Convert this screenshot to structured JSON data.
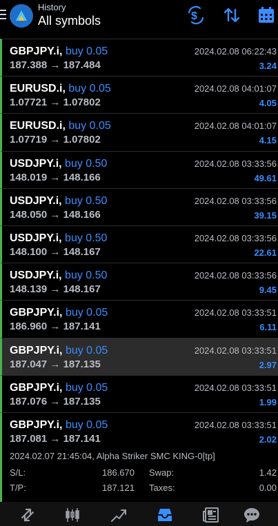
{
  "header": {
    "subtitle": "History",
    "title": "All symbols"
  },
  "deals": [
    {
      "symbol": "GBPJPY.i,",
      "action": "buy 0.05",
      "open": "187.388",
      "close": "187.484",
      "time": "2024.02.08 06:22:43",
      "profit": "3.24"
    },
    {
      "symbol": "EURUSD.i,",
      "action": "buy 0.05",
      "open": "1.07721",
      "close": "1.07802",
      "time": "2024.02.08 04:01:07",
      "profit": "4.05"
    },
    {
      "symbol": "EURUSD.i,",
      "action": "buy 0.05",
      "open": "1.07719",
      "close": "1.07802",
      "time": "2024.02.08 04:01:07",
      "profit": "4.15"
    },
    {
      "symbol": "USDJPY.i,",
      "action": "buy 0.50",
      "open": "148.019",
      "close": "148.166",
      "time": "2024.02.08 03:33:56",
      "profit": "49.61"
    },
    {
      "symbol": "USDJPY.i,",
      "action": "buy 0.50",
      "open": "148.050",
      "close": "148.166",
      "time": "2024.02.08 03:33:56",
      "profit": "39.15"
    },
    {
      "symbol": "USDJPY.i,",
      "action": "buy 0.50",
      "open": "148.100",
      "close": "148.167",
      "time": "2024.02.08 03:33:56",
      "profit": "22.61"
    },
    {
      "symbol": "USDJPY.i,",
      "action": "buy 0.50",
      "open": "148.139",
      "close": "148.167",
      "time": "2024.02.08 03:33:56",
      "profit": "9.45"
    },
    {
      "symbol": "GBPJPY.i,",
      "action": "buy 0.05",
      "open": "186.960",
      "close": "187.141",
      "time": "2024.02.08 03:33:51",
      "profit": "6.11"
    },
    {
      "symbol": "GBPJPY.i,",
      "action": "buy 0.05",
      "open": "187.047",
      "close": "187.135",
      "time": "2024.02.08 03:33:51",
      "profit": "2.97"
    },
    {
      "symbol": "GBPJPY.i,",
      "action": "buy 0.05",
      "open": "187.076",
      "close": "187.135",
      "time": "2024.02.08 03:33:51",
      "profit": "1.99"
    },
    {
      "symbol": "GBPJPY.i,",
      "action": "buy 0.05",
      "open": "187.081",
      "close": "187.141",
      "time": "2024.02.08 03:33:51",
      "profit": "2.02"
    }
  ],
  "details": {
    "comment": "2024.02.07 21:45:04, Alpha Striker SMC KING-0[tp]",
    "sl_label": "S/L:",
    "sl_value": "186.670",
    "tp_label": "T/P:",
    "tp_value": "187.121",
    "swap_label": "Swap:",
    "swap_value": "1.42",
    "taxes_label": "Taxes:",
    "taxes_value": "0.00"
  },
  "arrow": "→",
  "icons": {
    "header": [
      "menu-icon",
      "app-logo",
      "currency-exchange-icon",
      "sort-icon",
      "calendar-icon"
    ],
    "nav": [
      "quotes-icon",
      "chart-icon",
      "trade-icon",
      "history-icon",
      "news-icon",
      "chat-icon"
    ]
  },
  "colors": {
    "accent": "#3a8dff",
    "green_border": "#4caf50",
    "background": "#000000",
    "selected_row": "#2c2c2c"
  }
}
